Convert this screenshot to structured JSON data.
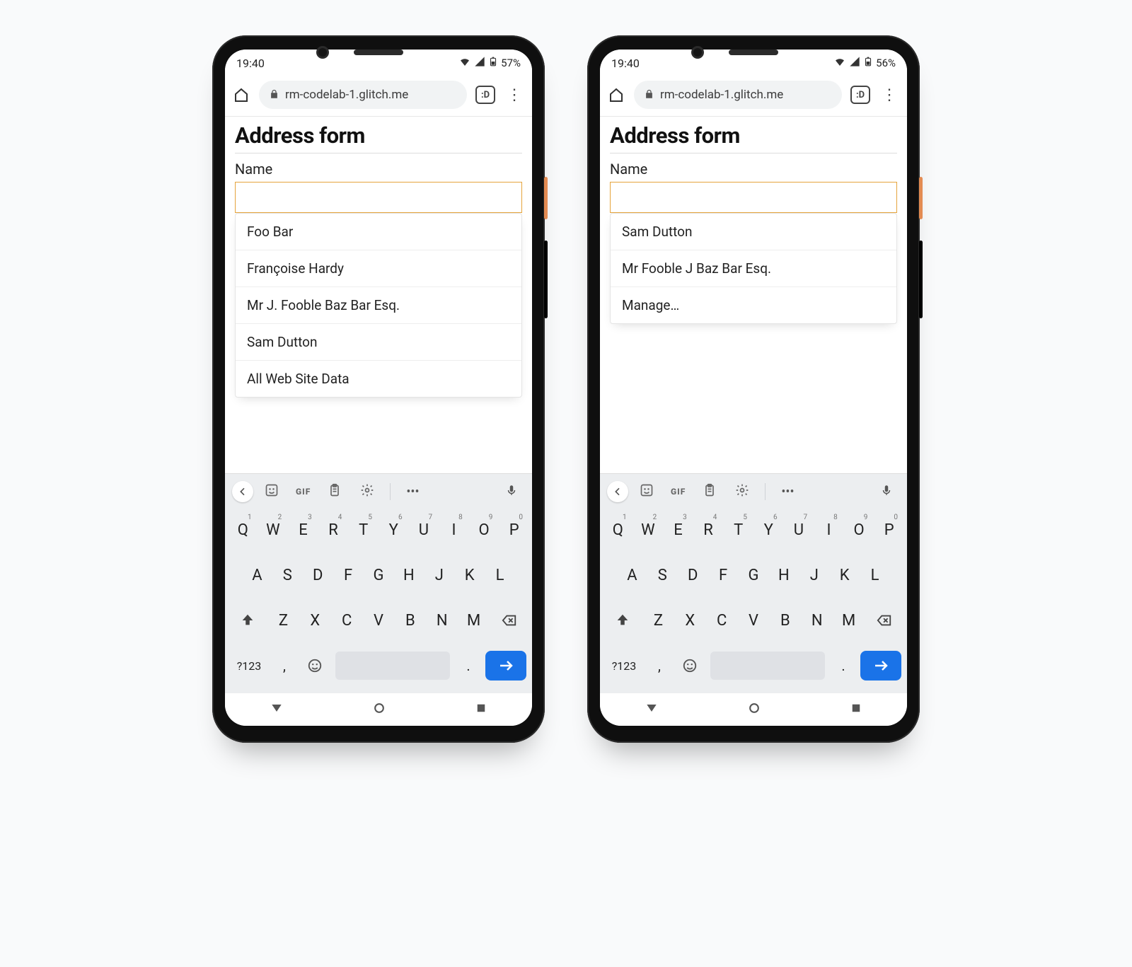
{
  "devices": [
    {
      "status": {
        "time": "19:40",
        "battery": "57%"
      },
      "browser": {
        "url": "rm-codelab-1.glitch.me",
        "tab_icon": ":D"
      },
      "page": {
        "title": "Address form",
        "name_label": "Name",
        "name_value": "",
        "suggestions": [
          "Foo Bar",
          "Françoise Hardy",
          "Mr J. Fooble Baz Bar Esq.",
          "Sam Dutton",
          "All Web Site Data"
        ]
      }
    },
    {
      "status": {
        "time": "19:40",
        "battery": "56%"
      },
      "browser": {
        "url": "rm-codelab-1.glitch.me",
        "tab_icon": ":D"
      },
      "page": {
        "title": "Address form",
        "name_label": "Name",
        "name_value": "",
        "suggestions": [
          "Sam Dutton",
          "Mr Fooble J Baz Bar Esq.",
          "Manage…"
        ]
      }
    }
  ],
  "keyboard": {
    "toolbar_gif": "GIF",
    "row1": [
      "Q",
      "W",
      "E",
      "R",
      "T",
      "Y",
      "U",
      "I",
      "O",
      "P"
    ],
    "row1_sup": [
      "1",
      "2",
      "3",
      "4",
      "5",
      "6",
      "7",
      "8",
      "9",
      "0"
    ],
    "row2": [
      "A",
      "S",
      "D",
      "F",
      "G",
      "H",
      "J",
      "K",
      "L"
    ],
    "row3": [
      "Z",
      "X",
      "C",
      "V",
      "B",
      "N",
      "M"
    ],
    "row4": {
      "symbols": "?123",
      "comma": ",",
      "period": "."
    }
  }
}
